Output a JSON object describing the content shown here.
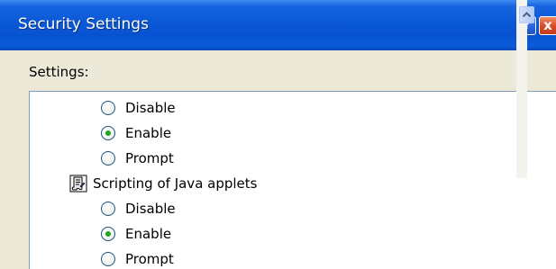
{
  "window": {
    "title": "Security Settings",
    "help_label": "?",
    "close_label": "x"
  },
  "settings_label": "Settings:",
  "list": {
    "option_group_1": [
      {
        "label": "Disable",
        "checked": false
      },
      {
        "label": "Enable",
        "checked": true
      },
      {
        "label": "Prompt",
        "checked": false
      }
    ],
    "setting_2": {
      "label": "Scripting of Java applets",
      "icon": "script-settings-icon"
    },
    "option_group_2": [
      {
        "label": "Disable",
        "checked": false
      },
      {
        "label": "Enable",
        "checked": true
      },
      {
        "label": "Prompt",
        "checked": false
      }
    ]
  },
  "scrollbar": {
    "up_icon": "chevron-up-icon"
  },
  "colors": {
    "titlebar": "#0a58d6",
    "dialog_background": "#ece9d8",
    "radio_selected": "#21a121",
    "list_border": "#7f9db9"
  }
}
